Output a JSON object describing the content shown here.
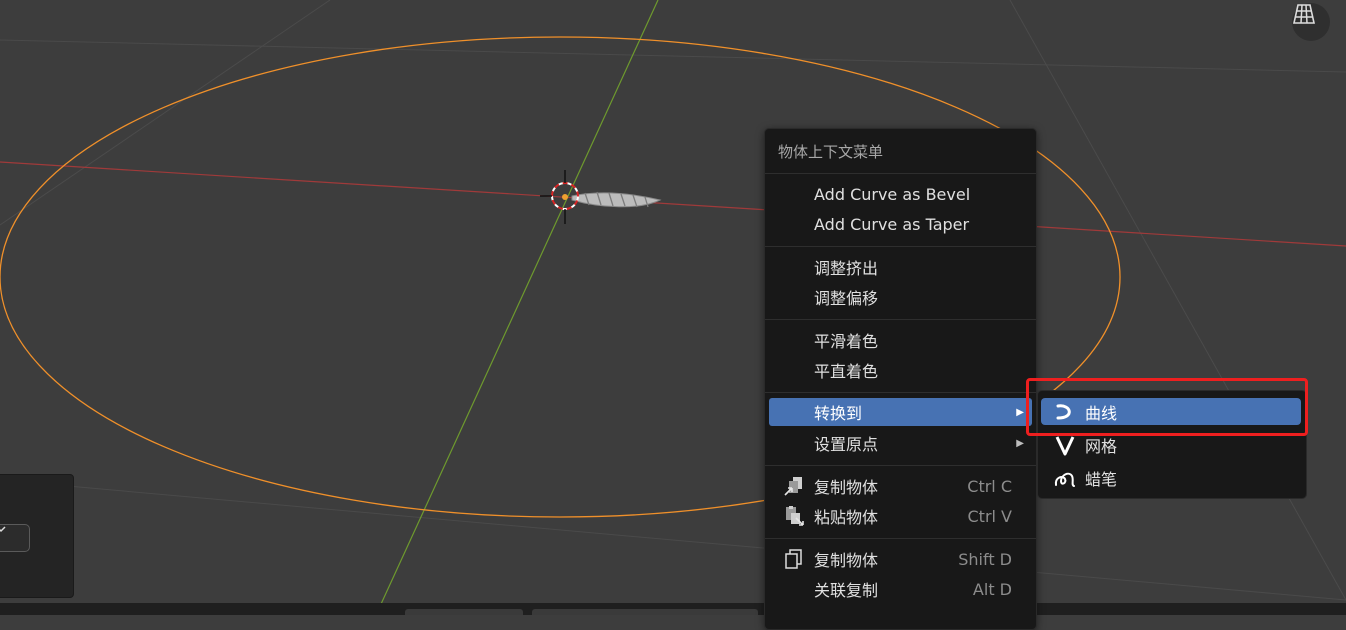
{
  "context_menu": {
    "title": "物体上下文菜单",
    "groups": [
      [
        {
          "label": "Add Curve as Bevel"
        },
        {
          "label": "Add Curve as Taper"
        }
      ],
      [
        {
          "label": "调整挤出"
        },
        {
          "label": "调整偏移"
        }
      ],
      [
        {
          "label": "平滑着色"
        },
        {
          "label": "平直着色"
        }
      ],
      [
        {
          "label": "转换到",
          "submenu": true,
          "active": true
        },
        {
          "label": "设置原点",
          "submenu": true
        }
      ],
      [
        {
          "label": "复制物体",
          "shortcut": "Ctrl C",
          "icon": "copy-icon"
        },
        {
          "label": "粘贴物体",
          "shortcut": "Ctrl V",
          "icon": "paste-icon"
        }
      ],
      [
        {
          "label": "复制物体",
          "shortcut": "Shift D",
          "icon": "duplicate-icon"
        },
        {
          "label": "关联复制",
          "shortcut": "Alt D"
        }
      ]
    ]
  },
  "convert_submenu": {
    "items": [
      {
        "label": "曲线",
        "icon": "curve-icon",
        "active": true
      },
      {
        "label": "网格",
        "icon": "mesh-icon"
      },
      {
        "label": "蜡笔",
        "icon": "grease-pencil-icon"
      }
    ]
  },
  "colors": {
    "viewport_bg": "#3d3d3d",
    "menu_bg": "#181818",
    "highlight": "#4772b3",
    "selection_outline": "#f0902a",
    "x_axis": "#a03a3a",
    "y_axis": "#6e9a2e",
    "annotation_box": "#ee1f1f"
  }
}
